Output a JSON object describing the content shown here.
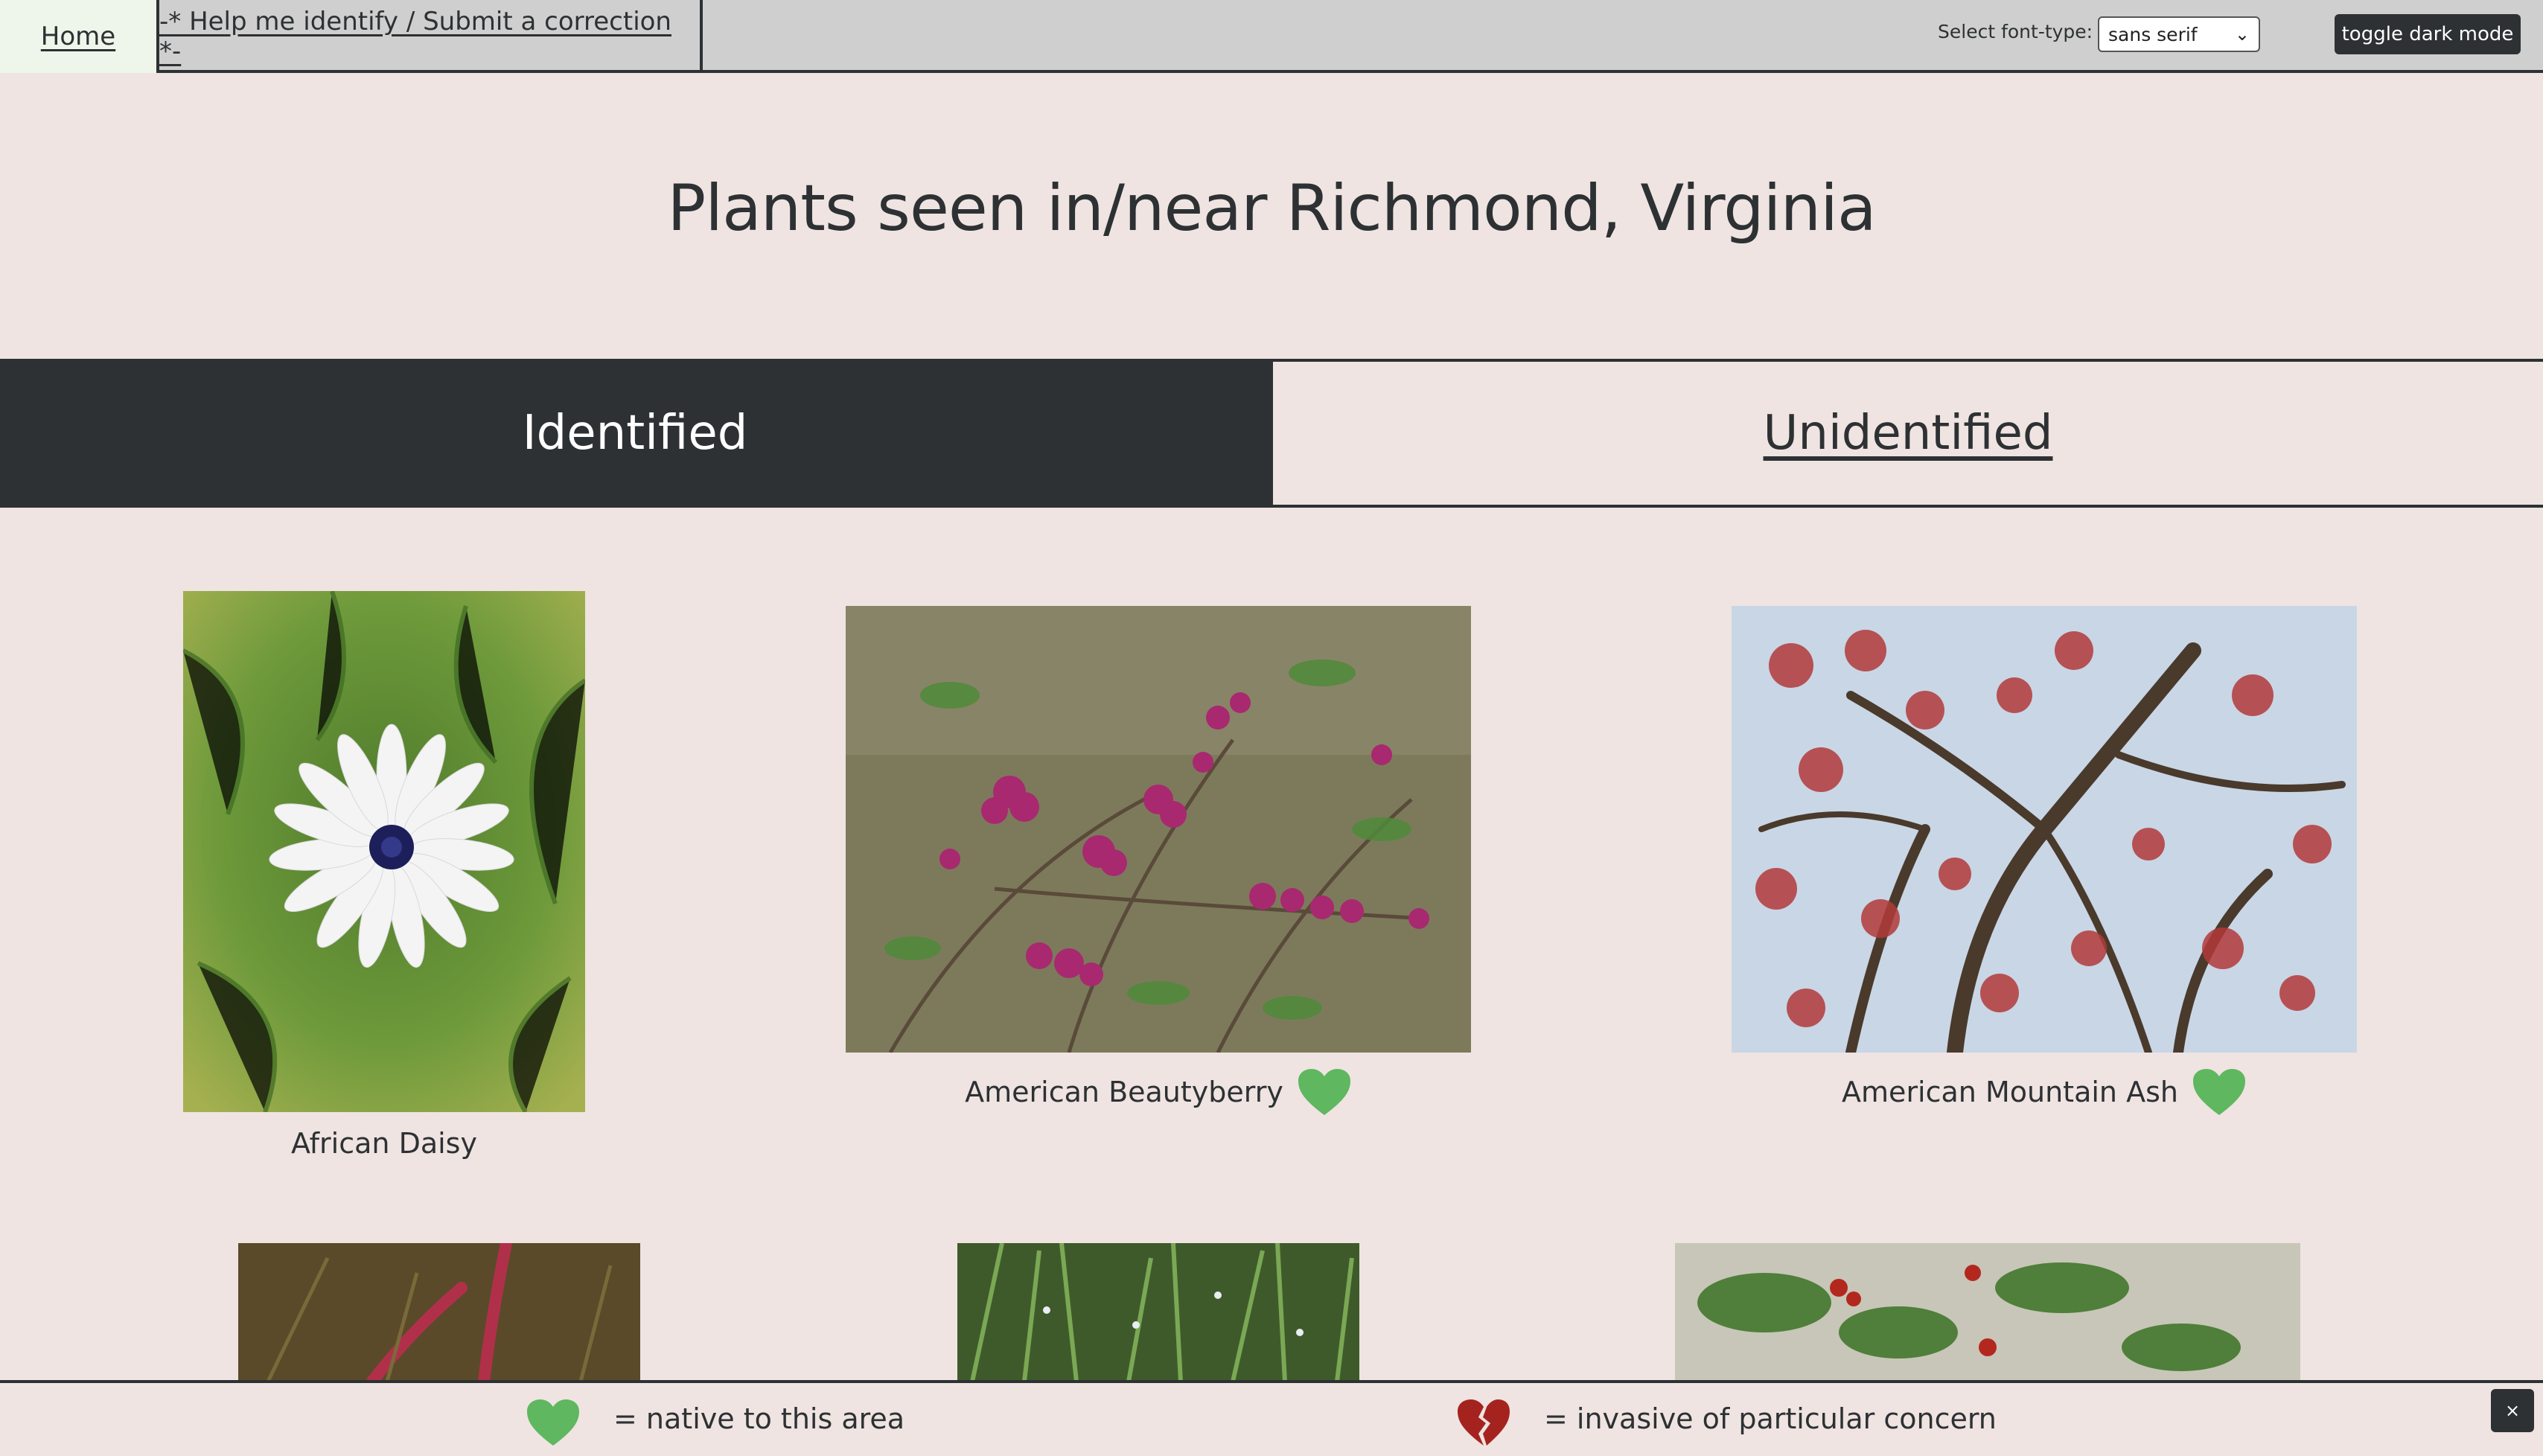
{
  "nav": {
    "home": "Home",
    "help": "-* Help me identify / Submit a correction *-",
    "font_label": "Select font-type:",
    "font_value": "sans serif",
    "dark_mode": "toggle dark mode"
  },
  "title": "Plants seen in/near Richmond, Virginia",
  "tabs": {
    "identified": "Identified",
    "unidentified": "Unidentified"
  },
  "plants": [
    {
      "name": "African Daisy",
      "native": false
    },
    {
      "name": "American Beautyberry",
      "native": true
    },
    {
      "name": "American Mountain Ash",
      "native": true
    }
  ],
  "legend": {
    "native": "= native to this area",
    "invasive": "= invasive of particular concern",
    "close": "×"
  },
  "colors": {
    "native_heart": "#5fb75f",
    "invasive_heart": "#a5231f",
    "dark": "#2d3133",
    "background": "#efe4e1"
  }
}
